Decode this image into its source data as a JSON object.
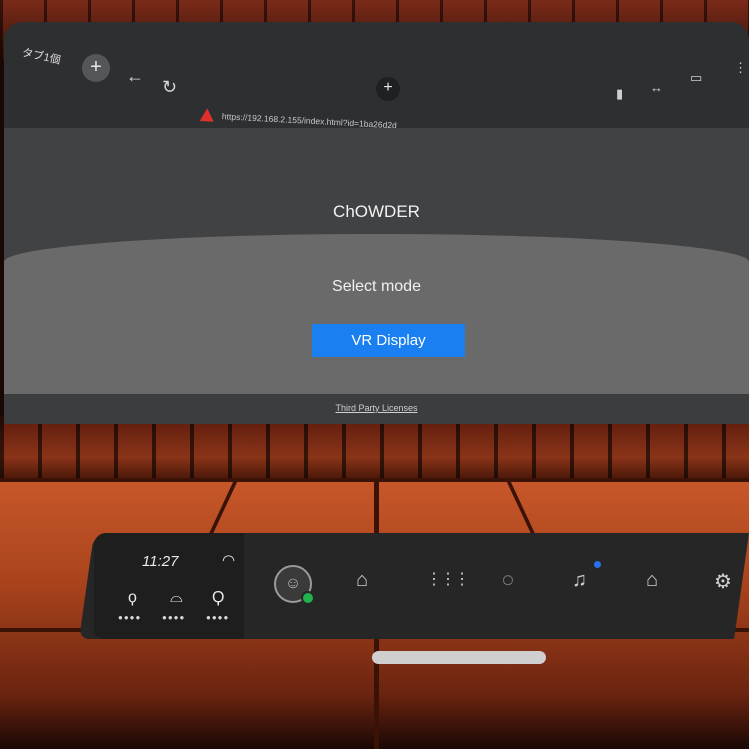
{
  "browser": {
    "tab_label": "タブ1個",
    "add_tab": "+",
    "add_center": "+",
    "back_icon": "←",
    "reload_icon": "↻",
    "url": "https://192.168.2.155/index.html?id=1ba26d2d",
    "bookmark_icon": "▮",
    "resize_icon": "↔",
    "display_icon": "▭",
    "menu_icon": "⋮"
  },
  "page": {
    "title": "ChOWDER",
    "subtitle": "Select mode",
    "vr_button": "VR Display",
    "licenses_link": "Third Party Licenses"
  },
  "dock": {
    "time": "11:27",
    "wifi_icon": "◠",
    "controller_left_icon": "ϙ",
    "headset_icon": "⌓",
    "controller_right_icon": "Ϙ",
    "dots_left": "●●●●",
    "dots_headset": "●●●●",
    "dots_right": "●●●●",
    "avatar_icon": "☺",
    "store_icon": "⌂",
    "apps_icon": "⋮⋮⋮",
    "messenger_icon": "◌",
    "bell_icon": "♫",
    "home_icon": "⌂",
    "settings_icon": "⚙"
  },
  "colors": {
    "accent_blue": "#1a7ff0",
    "online_green": "#22b24c",
    "warning_red": "#e0302a"
  }
}
